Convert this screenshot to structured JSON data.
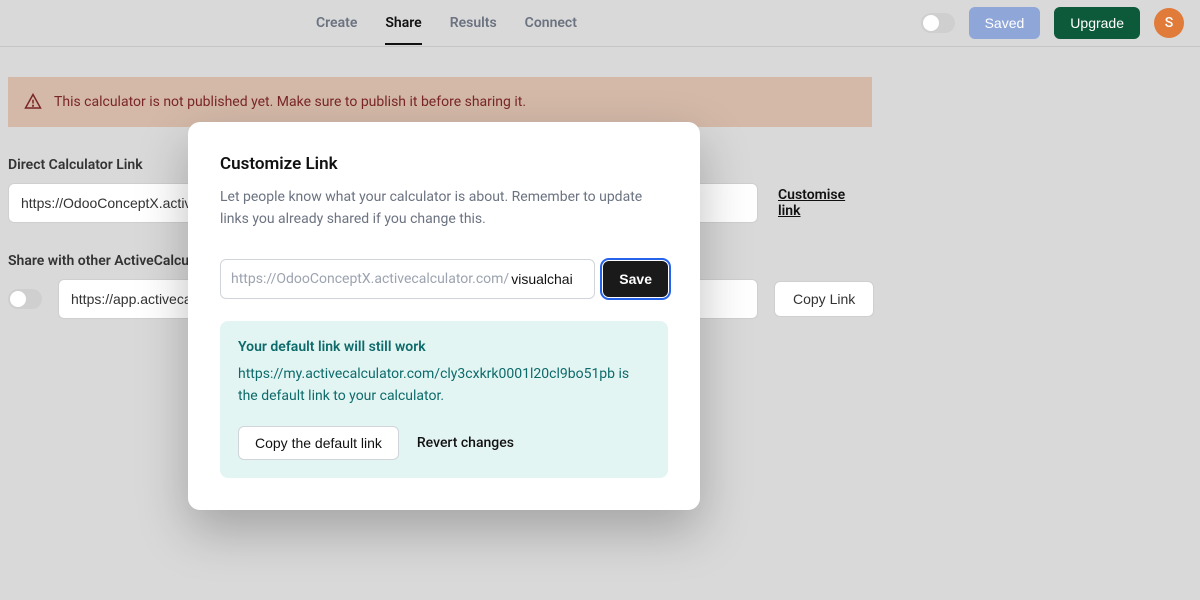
{
  "nav": {
    "tabs": [
      "Create",
      "Share",
      "Results",
      "Connect"
    ],
    "active_index": 1,
    "saved_label": "Saved",
    "upgrade_label": "Upgrade",
    "avatar_initial": "S"
  },
  "warning": {
    "text": "This calculator is not published yet. Make sure to publish it before sharing it."
  },
  "direct_link": {
    "label": "Direct Calculator Link",
    "url": "https://OdooConceptX.activecalculator.com/",
    "customise_label": "Customise link"
  },
  "share_other": {
    "label": "Share with other ActiveCalculator users",
    "url": "https://app.activecalculator.com/",
    "copy_label": "Copy Link"
  },
  "modal": {
    "title": "Customize Link",
    "description": "Let people know what your calculator is about. Remember to update links you already shared if you change this.",
    "input_prefix": "https://OdooConceptX.activecalculator.com/",
    "input_value": "visualchai",
    "save_label": "Save",
    "info": {
      "title": "Your default link will still work",
      "text": "https://my.activecalculator.com/cly3cxkrk0001l20cl9bo51pb is the default link to your calculator.",
      "copy_default_label": "Copy the default link",
      "revert_label": "Revert changes"
    }
  }
}
